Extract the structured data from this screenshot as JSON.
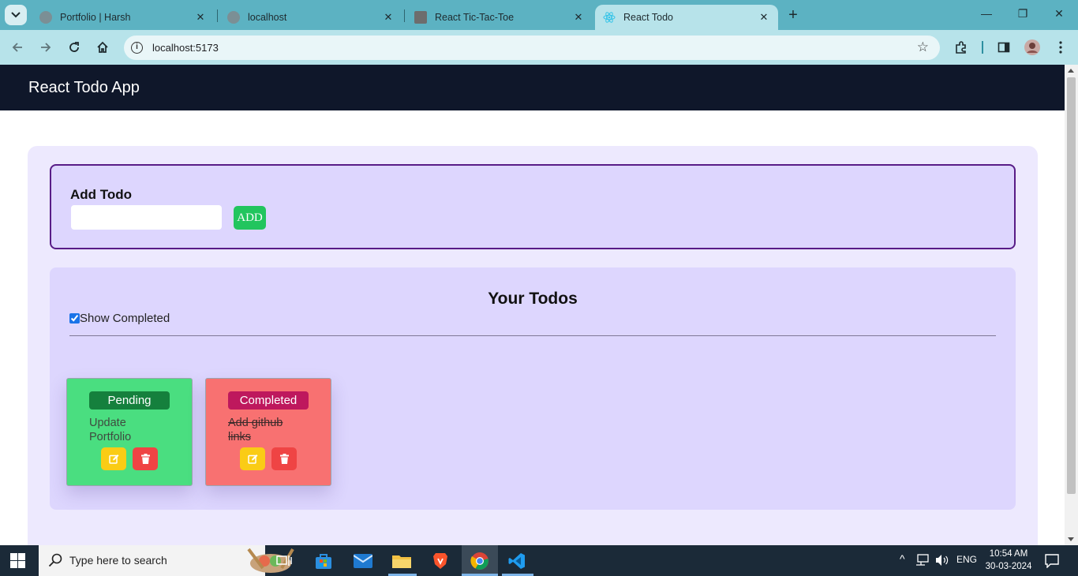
{
  "browser": {
    "tabs": [
      {
        "title": "Portfolio | Harsh"
      },
      {
        "title": "localhost"
      },
      {
        "title": "React Tic-Tac-Toe"
      },
      {
        "title": "React Todo",
        "active": true
      }
    ],
    "url": "localhost:5173"
  },
  "app": {
    "brand": "React Todo App",
    "add_section": {
      "heading": "Add Todo",
      "input_value": "",
      "button_label": "ADD"
    },
    "list_section": {
      "heading": "Your Todos",
      "show_completed_label": "Show Completed",
      "show_completed_checked": true,
      "todos": [
        {
          "status": "Pending",
          "text": "Update Portfolio",
          "completed": false,
          "card_color": "#4ade80",
          "badge_color": "#15803d"
        },
        {
          "status": "Completed",
          "text": "Add github links",
          "completed": true,
          "card_color": "#f87171",
          "badge_color": "#be185d"
        }
      ]
    }
  },
  "taskbar": {
    "search_placeholder": "Type here to search",
    "language": "ENG",
    "time": "10:54 AM",
    "date": "30-03-2024"
  },
  "colors": {
    "navbar": "#0f172a",
    "add_button": "#22c55e",
    "edit_button": "#facc15",
    "delete_button": "#ef4444"
  }
}
